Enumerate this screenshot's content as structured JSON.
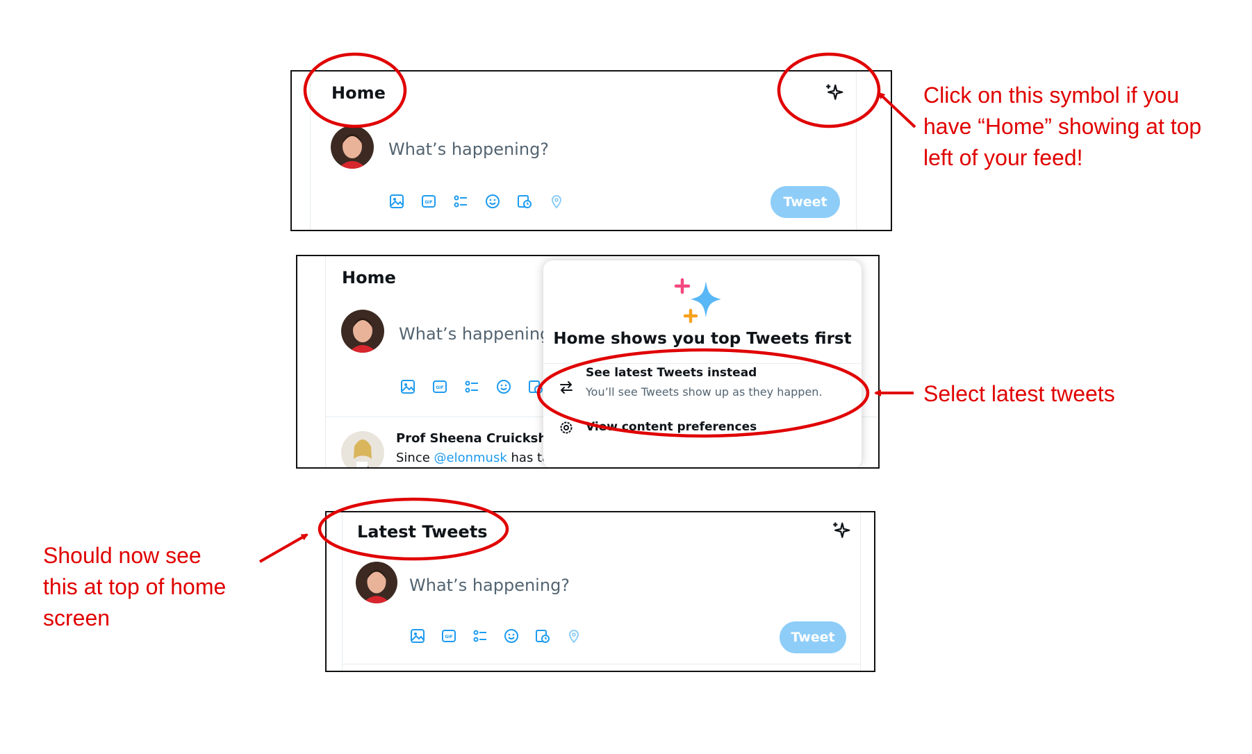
{
  "panel1": {
    "header_title": "Home",
    "compose_placeholder": "What’s happening?",
    "tweet_button": "Tweet",
    "sparkle_icon": "sparkle-icon"
  },
  "panel2": {
    "header_title": "Home",
    "compose_placeholder": "What’s happening",
    "feed_author": "Prof Sheena Cruickshai",
    "feed_text_prefix": "Since ",
    "feed_mention": "@elonmusk",
    "feed_text_suffix": " has ta",
    "popup": {
      "title": "Home shows you top Tweets first",
      "option_latest_title": "See latest Tweets instead",
      "option_latest_sub": "You’ll see Tweets show up as they happen.",
      "option_prefs": "View content preferences"
    }
  },
  "panel3": {
    "header_title": "Latest Tweets",
    "compose_placeholder": "What’s happening?",
    "tweet_button": "Tweet"
  },
  "annotations": {
    "click_symbol": [
      "Click on this symbol if you",
      "have “Home” showing at top",
      "left of your feed!"
    ],
    "select_latest": "Select latest tweets",
    "should_now_see": [
      "Should now see",
      "this at top of home",
      "screen"
    ]
  },
  "colors": {
    "annotation_red": "#e00000",
    "twitter_blue": "#1d9bf0",
    "tweet_button_disabled": "#8ecdf8",
    "sparkle_pink": "#f4487f",
    "sparkle_orange": "#f7a11e",
    "sparkle_blue": "#59b7f5"
  },
  "toolbar_icons": [
    "image-icon",
    "gif-icon",
    "poll-icon",
    "emoji-icon",
    "schedule-icon",
    "location-icon"
  ]
}
